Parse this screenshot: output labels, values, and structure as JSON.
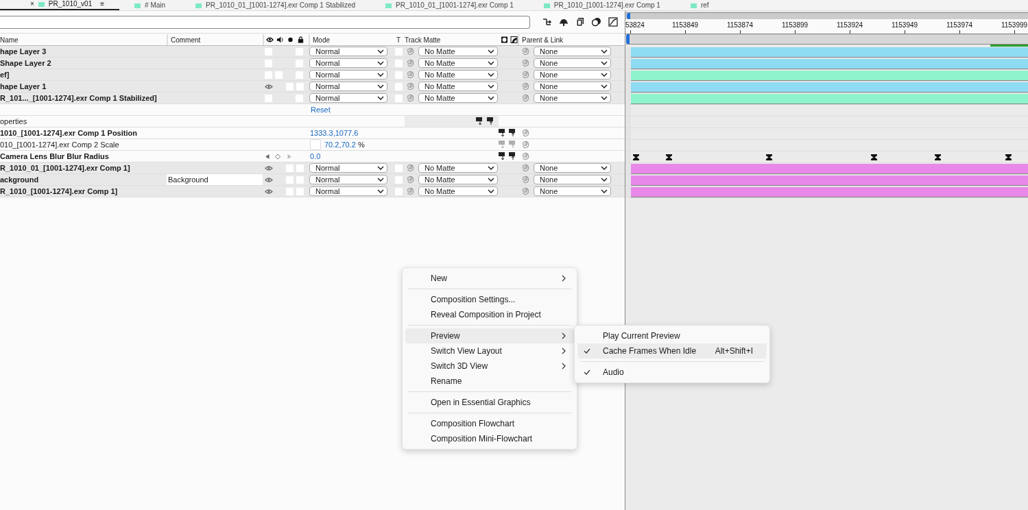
{
  "tabs": [
    {
      "label": "PR_1010_v01",
      "selected": true,
      "close": "×",
      "menu": "≡"
    },
    {
      "label": "# Main",
      "selected": false
    },
    {
      "label": "PR_1010_01_[1001-1274].exr Comp 1 Stabilized",
      "selected": false
    },
    {
      "label": "PR_1010_01_[1001-1274].exr Comp 1",
      "selected": false
    },
    {
      "label": "PR_1010_[1001-1274].exr Comp 1",
      "selected": false
    },
    {
      "label": "ref",
      "selected": false
    }
  ],
  "columns": {
    "name": "Name",
    "comment": "Comment",
    "mode": "Mode",
    "t": "T",
    "track_matte": "Track Matte",
    "parent": "Parent & Link"
  },
  "rows": [
    {
      "kind": "layer",
      "name": "hape Layer 3",
      "video": false,
      "audio": false,
      "solo": false,
      "locked": false,
      "preserve_transparency": false,
      "mode": "Normal",
      "track_matte": "No Matte",
      "parent": "None",
      "color": "#8edcf3"
    },
    {
      "kind": "layer",
      "name": "  Shape Layer 2",
      "video": false,
      "audio": false,
      "solo": false,
      "locked": false,
      "preserve_transparency": false,
      "mode": "Normal",
      "track_matte": "No Matte",
      "parent": "None",
      "color": "#8edcf3"
    },
    {
      "kind": "layer",
      "name": "ef]",
      "video": false,
      "audio": true,
      "solo": false,
      "locked": false,
      "preserve_transparency": false,
      "mode": "Normal",
      "track_matte": "No Matte",
      "parent": "None",
      "color": "#8ff4cc"
    },
    {
      "kind": "layer",
      "name": "hape Layer 1",
      "video": true,
      "audio": false,
      "solo": true,
      "locked": false,
      "preserve_transparency": false,
      "mode": "Normal",
      "track_matte": "No Matte",
      "parent": "None",
      "color": "#8edcf3"
    },
    {
      "kind": "layer",
      "name": "R_101..._[1001-1274].exr Comp 1 Stabilized]",
      "video": false,
      "audio": false,
      "solo": false,
      "locked": false,
      "preserve_transparency": false,
      "mode": "Normal",
      "track_matte": "No Matte",
      "parent": "None",
      "color": "#8ff4cc"
    },
    {
      "kind": "reset",
      "label": "Reset"
    },
    {
      "kind": "group",
      "name": "operties"
    },
    {
      "kind": "property",
      "name": "1010_[1001-1274].exr Comp 1 Position",
      "bold": true,
      "value": "1333.3,1077.6",
      "dimmed": false,
      "navigator": false,
      "keyframes": false
    },
    {
      "kind": "property",
      "name": "010_[1001-1274].exr Comp 2 Scale",
      "bold": false,
      "value": "70.2,70.2",
      "unit": "%",
      "constrain": false,
      "dimmed": true,
      "navigator": false,
      "keyframes": false
    },
    {
      "kind": "property",
      "name": "Camera Lens Blur Blur Radius",
      "bold": true,
      "value": "0.0",
      "dimmed": false,
      "navigator": true,
      "keyframes": true
    },
    {
      "kind": "layer",
      "name": "R_1010_01_[1001-1274].exr Comp 1]",
      "video": true,
      "audio": false,
      "solo": true,
      "locked": false,
      "preserve_transparency": false,
      "mode": "Normal",
      "track_matte": "No Matte",
      "parent": "None",
      "color": "#e888e8"
    },
    {
      "kind": "layer",
      "name": "ackground",
      "comment": "Background",
      "video": true,
      "audio": false,
      "solo": true,
      "locked": false,
      "preserve_transparency": false,
      "mode": "Normal",
      "track_matte": "No Matte",
      "parent": "None",
      "color": "#e888e8"
    },
    {
      "kind": "layer",
      "name": "R_1010_[1001-1274].exr Comp 1]",
      "video": true,
      "audio": false,
      "solo": true,
      "locked": false,
      "preserve_transparency": false,
      "mode": "Normal",
      "track_matte": "No Matte",
      "parent": "None",
      "color": "#e888e8"
    }
  ],
  "ruler": [
    "53824",
    "1153849",
    "1153874",
    "1153899",
    "1153924",
    "1153949",
    "1153974",
    "1153999"
  ],
  "context_menu": [
    {
      "kind": "item",
      "label": "New",
      "submenu": true,
      "selected": false
    },
    {
      "kind": "separator"
    },
    {
      "kind": "item",
      "label": "Composition Settings...",
      "submenu": false,
      "selected": false
    },
    {
      "kind": "item",
      "label": "Reveal Composition in Project",
      "submenu": false,
      "selected": false
    },
    {
      "kind": "separator"
    },
    {
      "kind": "item",
      "label": "Preview",
      "submenu": true,
      "selected": true
    },
    {
      "kind": "item",
      "label": "Switch View Layout",
      "submenu": true,
      "selected": false
    },
    {
      "kind": "item",
      "label": "Switch 3D View",
      "submenu": true,
      "selected": false
    },
    {
      "kind": "item",
      "label": "Rename",
      "submenu": false,
      "selected": false
    },
    {
      "kind": "separator"
    },
    {
      "kind": "item",
      "label": "Open in Essential Graphics",
      "submenu": false,
      "selected": false
    },
    {
      "kind": "separator"
    },
    {
      "kind": "item",
      "label": "Composition Flowchart",
      "submenu": false,
      "selected": false
    },
    {
      "kind": "item",
      "label": "Composition Mini-Flowchart",
      "submenu": false,
      "selected": false
    }
  ],
  "submenu": [
    {
      "kind": "item",
      "label": "Play Current Preview",
      "checked": false,
      "selected": false
    },
    {
      "kind": "item",
      "label": "Cache Frames When Idle",
      "checked": true,
      "selected": true,
      "shortcut": "Alt+Shift+I"
    },
    {
      "kind": "separator"
    },
    {
      "kind": "item",
      "label": "Audio",
      "checked": true,
      "selected": false
    }
  ]
}
